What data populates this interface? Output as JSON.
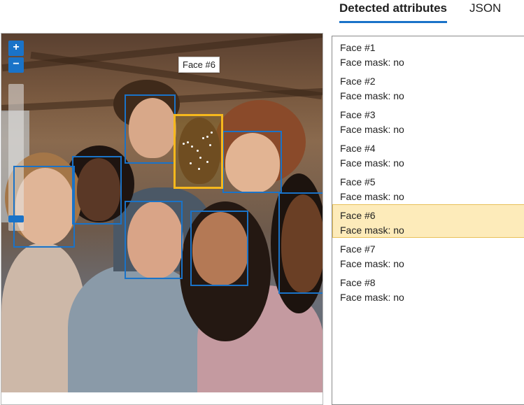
{
  "tabs": [
    {
      "label": "Detected attributes",
      "active": true
    },
    {
      "label": "JSON",
      "active": false
    }
  ],
  "viewer": {
    "zoom_in_label": "+",
    "zoom_out_label": "−",
    "tooltip": "Face #6"
  },
  "faces": [
    {
      "title": "Face #1",
      "mask": "Face mask: no",
      "selected": false
    },
    {
      "title": "Face #2",
      "mask": "Face mask: no",
      "selected": false
    },
    {
      "title": "Face #3",
      "mask": "Face mask: no",
      "selected": false
    },
    {
      "title": "Face #4",
      "mask": "Face mask: no",
      "selected": false
    },
    {
      "title": "Face #5",
      "mask": "Face mask: no",
      "selected": false
    },
    {
      "title": "Face #6",
      "mask": "Face mask: no",
      "selected": true
    },
    {
      "title": "Face #7",
      "mask": "Face mask: no",
      "selected": false
    },
    {
      "title": "Face #8",
      "mask": "Face mask: no",
      "selected": false
    }
  ],
  "colors": {
    "accent": "#1a73c8",
    "selected_box": "#f6b81d",
    "selected_row": "#fdebba"
  }
}
